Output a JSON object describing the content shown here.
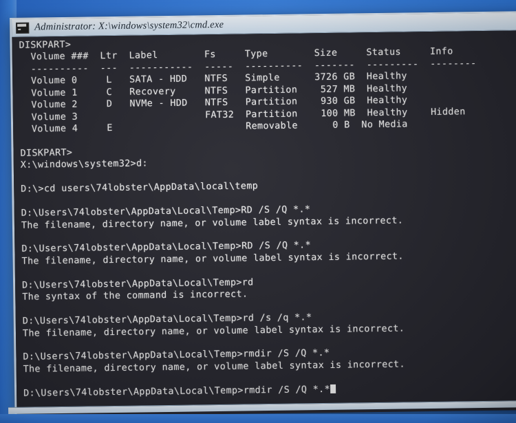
{
  "window": {
    "title": "Administrator: X:\\windows\\system32\\cmd.exe",
    "icon": "cmd-console-icon",
    "background_color": "#26262e",
    "titlebar_color": "#e4eef8",
    "desktop_color": "#2f79df"
  },
  "console": {
    "diskpart_prompt_top": "DISKPART>",
    "table": {
      "headers": [
        "  Volume ###",
        "Ltr",
        "Label",
        "Fs",
        "Type",
        "Size",
        "Status",
        "Info"
      ],
      "header_line": "  Volume ###  Ltr  Label        Fs     Type        Size     Status     Info",
      "separator_line": "  ----------  ---  -----------  -----  ----------  -------  ---------  --------",
      "rows": [
        {
          "volume": "  Volume 0",
          "ltr": "L",
          "label": "SATA - HDD",
          "fs": "NTFS",
          "type": "Simple",
          "size": "3726 GB",
          "status": "Healthy",
          "info": "",
          "line": "  Volume 0     L   SATA - HDD   NTFS   Simple      3726 GB  Healthy"
        },
        {
          "volume": "  Volume 1",
          "ltr": "C",
          "label": "Recovery",
          "fs": "NTFS",
          "type": "Partition",
          "size": "527 MB",
          "status": "Healthy",
          "info": "",
          "line": "  Volume 1     C   Recovery     NTFS   Partition    527 MB  Healthy"
        },
        {
          "volume": "  Volume 2",
          "ltr": "D",
          "label": "NVMe - HDD",
          "fs": "NTFS",
          "type": "Partition",
          "size": "930 GB",
          "status": "Healthy",
          "info": "",
          "line": "  Volume 2     D   NVMe - HDD   NTFS   Partition    930 GB  Healthy"
        },
        {
          "volume": "  Volume 3",
          "ltr": "",
          "label": "",
          "fs": "FAT32",
          "type": "Partition",
          "size": "100 MB",
          "status": "Healthy",
          "info": "Hidden",
          "line": "  Volume 3                      FAT32  Partition    100 MB  Healthy    Hidden"
        },
        {
          "volume": "  Volume 4",
          "ltr": "E",
          "label": "",
          "fs": "",
          "type": "Removable",
          "size": "0 B",
          "status": "No Media",
          "info": "",
          "line": "  Volume 4     E                       Removable      0 B  No Media"
        }
      ]
    },
    "lines": [
      "DISKPART>",
      "X:\\windows\\system32>d:",
      "",
      "D:\\>cd users\\74lobster\\AppData\\local\\temp",
      "",
      "D:\\Users\\74lobster\\AppData\\Local\\Temp>RD /S /Q *.*",
      "The filename, directory name, or volume label syntax is incorrect.",
      "",
      "D:\\Users\\74lobster\\AppData\\Local\\Temp>RD /S /Q *.*",
      "The filename, directory name, or volume label syntax is incorrect.",
      "",
      "D:\\Users\\74lobster\\AppData\\Local\\Temp>rd",
      "The syntax of the command is incorrect.",
      "",
      "D:\\Users\\74lobster\\AppData\\Local\\Temp>rd /s /q *.*",
      "The filename, directory name, or volume label syntax is incorrect.",
      "",
      "D:\\Users\\74lobster\\AppData\\Local\\Temp>rmdir /S /Q *.*",
      "The filename, directory name, or volume label syntax is incorrect.",
      ""
    ],
    "active_line": "D:\\Users\\74lobster\\AppData\\Local\\Temp>rmdir /S /Q *.*",
    "cursor": "block-cursor"
  }
}
